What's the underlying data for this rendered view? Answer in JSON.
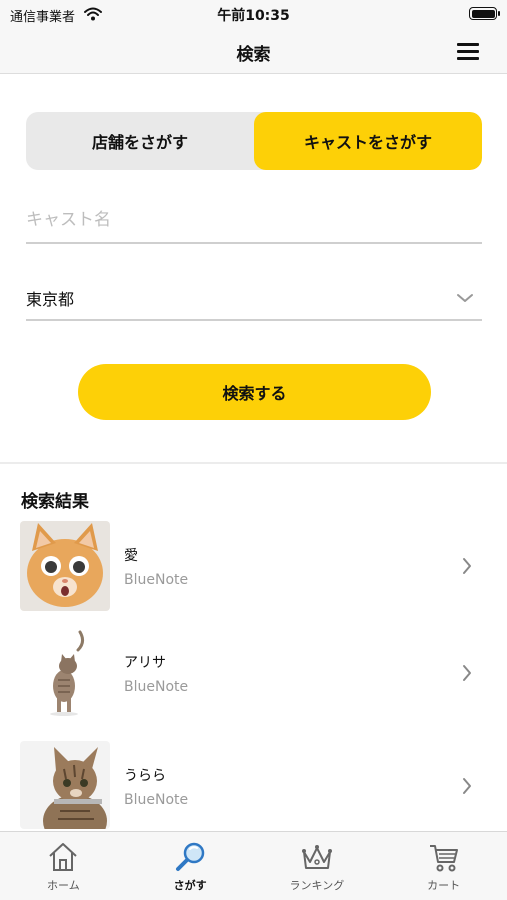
{
  "status_bar": {
    "carrier": "通信事業者",
    "time": "午前10:35"
  },
  "nav": {
    "title": "検索"
  },
  "segment": {
    "options": [
      "店舗をさがす",
      "キャストをさがす"
    ],
    "active_index": 1
  },
  "form": {
    "cast_name_placeholder": "キャスト名",
    "cast_name_value": "",
    "prefecture": "東京都",
    "search_button": "検索する"
  },
  "results": {
    "title": "検索結果",
    "items": [
      {
        "name": "愛",
        "shop": "BlueNote"
      },
      {
        "name": "アリサ",
        "shop": "BlueNote"
      },
      {
        "name": "うらら",
        "shop": "BlueNote"
      }
    ]
  },
  "tabs": [
    {
      "label": "ホーム",
      "icon": "home-icon"
    },
    {
      "label": "さがす",
      "icon": "magnifier-icon"
    },
    {
      "label": "ランキング",
      "icon": "crown-icon"
    },
    {
      "label": "カート",
      "icon": "cart-icon"
    }
  ],
  "active_tab_index": 1,
  "colors": {
    "accent": "#fdd007",
    "segment_inactive": "#e9e9e9",
    "bar_background": "#f7f7f7"
  }
}
